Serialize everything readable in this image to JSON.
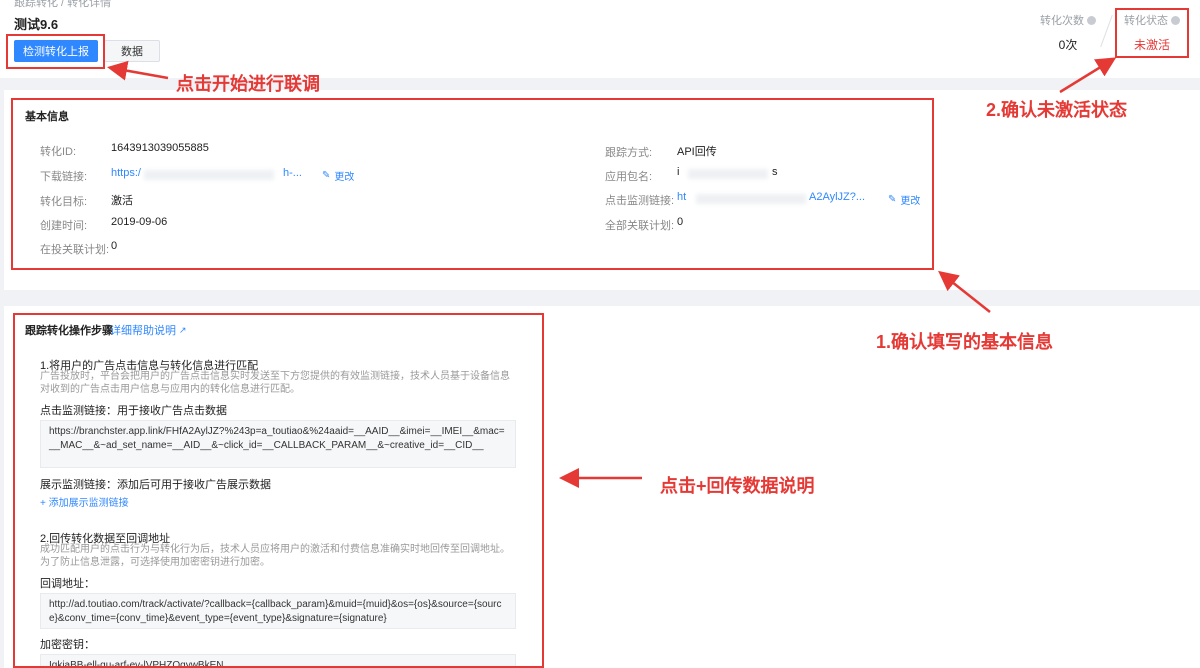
{
  "header": {
    "breadcrumb": "跟踪转化 / 转化详情",
    "title": "测试9.6",
    "primary_button": "检测转化上报",
    "secondary_button": "数据",
    "conversions_label": "转化次数",
    "conversions_value": "0次",
    "status_label": "转化状态",
    "status_value": "未激活"
  },
  "annotations": {
    "click_start": "点击开始进行联调",
    "confirm_status": "2.确认未激活状态",
    "confirm_info": "1.确认填写的基本信息",
    "click_plus": "点击+回传数据说明"
  },
  "basic_info": {
    "title": "基本信息",
    "left": [
      {
        "label": "转化ID:",
        "value": "1643913039055885"
      },
      {
        "label": "下载链接:",
        "value": "https:/",
        "suffix": "h-..."
      },
      {
        "label": "转化目标:",
        "value": "激活"
      },
      {
        "label": "创建时间:",
        "value": "2019-09-06"
      },
      {
        "label": "在投关联计划:",
        "value": "0"
      }
    ],
    "right": [
      {
        "label": "跟踪方式:",
        "value": "API回传"
      },
      {
        "label": "应用包名:",
        "value": "i",
        "suffix": "s"
      },
      {
        "label": "点击监测链接:",
        "value": "ht",
        "suffix": "A2AylJZ?..."
      },
      {
        "label": "全部关联计划:",
        "value": "0"
      }
    ],
    "edit_label": "更改"
  },
  "steps": {
    "title": "跟踪转化操作步骤",
    "help_link": "详细帮助说明",
    "step1_heading": "1.将用户的广告点击信息与转化信息进行匹配",
    "step1_desc": "广告投放时，平台会把用户的广告点击信息实时发送至下方您提供的有效监测链接，技术人员基于设备信息对收到的广告点击用户信息与应用内的转化信息进行匹配。",
    "click_monitor_label": "点击监测链接：用于接收广告点击数据",
    "click_monitor_url": "https://branchster.app.link/FHfA2AylJZ?%243p=a_toutiao&%24aaid=__AAID__&imei=__IMEI__&mac=__MAC__&~ad_set_name=__AID__&~click_id=__CALLBACK_PARAM__&~creative_id=__CID__",
    "display_monitor_label": "展示监测链接：添加后可用于接收广告展示数据",
    "add_display_link": "+ 添加展示监测链接",
    "step2_heading": "2.回传转化数据至回调地址",
    "step2_desc": "成功匹配用户的点击行为与转化行为后，技术人员应将用户的激活和付费信息准确实时地回传至回调地址。为了防止信息泄露，可选择使用加密密钥进行加密。",
    "callback_label": "回调地址：",
    "callback_url": "http://ad.toutiao.com/track/activate/?callback={callback_param}&muid={muid}&os={os}&source={source}&conv_time={conv_time}&event_type={event_type}&signature={signature}",
    "secret_label": "加密密钥：",
    "secret_value": "IqkjaBB-ell-gu-arf-ev-lVPHZQgywBkEN"
  },
  "colors": {
    "accent": "#2f88ff",
    "annotation": "#e53935",
    "status_inactive": "#e53935"
  }
}
